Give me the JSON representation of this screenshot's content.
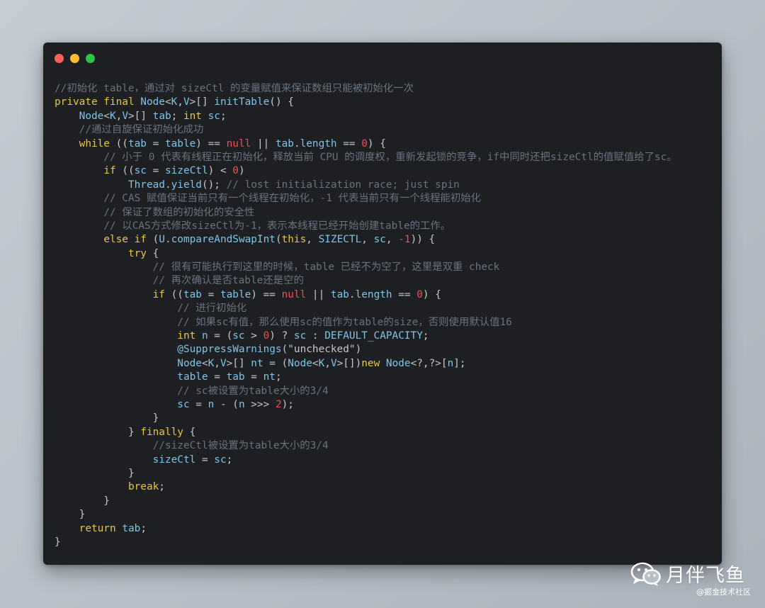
{
  "window": {
    "controls": {
      "close_color": "#fe5f57",
      "minimize_color": "#febc2e",
      "maximize_color": "#28c840"
    }
  },
  "code_lines": [
    [
      [
        "cm",
        "//初始化 table，通过对 sizeCtl 的变量赋值来保证数组只能被初始化一次"
      ]
    ],
    [
      [
        "kw",
        "private final "
      ],
      [
        "ty",
        "Node"
      ],
      [
        "op",
        "<"
      ],
      [
        "ty",
        "K"
      ],
      [
        "op",
        ","
      ],
      [
        "ty",
        "V"
      ],
      [
        "op",
        ">[] "
      ],
      [
        "id",
        "initTable"
      ],
      [
        "op",
        "() {"
      ]
    ],
    [
      [
        "op",
        "    "
      ],
      [
        "ty",
        "Node"
      ],
      [
        "op",
        "<"
      ],
      [
        "ty",
        "K"
      ],
      [
        "op",
        ","
      ],
      [
        "ty",
        "V"
      ],
      [
        "op",
        ">[] "
      ],
      [
        "id",
        "tab"
      ],
      [
        "op",
        "; "
      ],
      [
        "kw",
        "int "
      ],
      [
        "id",
        "sc"
      ],
      [
        "op",
        ";"
      ]
    ],
    [
      [
        "op",
        "    "
      ],
      [
        "cm",
        "//通过自旋保证初始化成功"
      ]
    ],
    [
      [
        "op",
        "    "
      ],
      [
        "kw",
        "while "
      ],
      [
        "op",
        "(("
      ],
      [
        "id",
        "tab"
      ],
      [
        "op",
        " = "
      ],
      [
        "id",
        "table"
      ],
      [
        "op",
        ") == "
      ],
      [
        "lit",
        "null"
      ],
      [
        "op",
        " || "
      ],
      [
        "id",
        "tab"
      ],
      [
        "op",
        "."
      ],
      [
        "id",
        "length"
      ],
      [
        "op",
        " == "
      ],
      [
        "num",
        "0"
      ],
      [
        "op",
        ") {"
      ]
    ],
    [
      [
        "op",
        "        "
      ],
      [
        "cm",
        "// 小于 0 代表有线程正在初始化，释放当前 CPU 的调度权，重新发起锁的竞争，if中同时还把sizeCtl的值赋值给了sc。"
      ]
    ],
    [
      [
        "op",
        "        "
      ],
      [
        "kw",
        "if "
      ],
      [
        "op",
        "(("
      ],
      [
        "id",
        "sc"
      ],
      [
        "op",
        " = "
      ],
      [
        "id",
        "sizeCtl"
      ],
      [
        "op",
        ") < "
      ],
      [
        "num",
        "0"
      ],
      [
        "op",
        ")"
      ]
    ],
    [
      [
        "op",
        "            "
      ],
      [
        "ty",
        "Thread"
      ],
      [
        "op",
        "."
      ],
      [
        "id",
        "yield"
      ],
      [
        "op",
        "(); "
      ],
      [
        "cm",
        "// lost initialization race; just spin"
      ]
    ],
    [
      [
        "op",
        "        "
      ],
      [
        "cm",
        "// CAS 赋值保证当前只有一个线程在初始化，-1 代表当前只有一个线程能初始化"
      ]
    ],
    [
      [
        "op",
        "        "
      ],
      [
        "cm",
        "// 保证了数组的初始化的安全性"
      ]
    ],
    [
      [
        "op",
        "        "
      ],
      [
        "cm",
        "// 以CAS方式修改sizeCtl为-1，表示本线程已经开始创建table的工作。"
      ]
    ],
    [
      [
        "op",
        "        "
      ],
      [
        "kw",
        "else if "
      ],
      [
        "op",
        "("
      ],
      [
        "ty",
        "U"
      ],
      [
        "op",
        "."
      ],
      [
        "id",
        "compareAndSwapInt"
      ],
      [
        "op",
        "("
      ],
      [
        "kw",
        "this"
      ],
      [
        "op",
        ", "
      ],
      [
        "id",
        "SIZECTL"
      ],
      [
        "op",
        ", "
      ],
      [
        "id",
        "sc"
      ],
      [
        "op",
        ", "
      ],
      [
        "num",
        "-1"
      ],
      [
        "op",
        ")) {"
      ]
    ],
    [
      [
        "op",
        "            "
      ],
      [
        "kw",
        "try "
      ],
      [
        "op",
        "{"
      ]
    ],
    [
      [
        "op",
        "                "
      ],
      [
        "cm",
        "// 很有可能执行到这里的时候，table 已经不为空了，这里是双重 check"
      ]
    ],
    [
      [
        "op",
        "                "
      ],
      [
        "cm",
        "// 再次确认是否table还是空的"
      ]
    ],
    [
      [
        "op",
        "                "
      ],
      [
        "kw",
        "if "
      ],
      [
        "op",
        "(("
      ],
      [
        "id",
        "tab"
      ],
      [
        "op",
        " = "
      ],
      [
        "id",
        "table"
      ],
      [
        "op",
        ") == "
      ],
      [
        "lit",
        "null"
      ],
      [
        "op",
        " || "
      ],
      [
        "id",
        "tab"
      ],
      [
        "op",
        "."
      ],
      [
        "id",
        "length"
      ],
      [
        "op",
        " == "
      ],
      [
        "num",
        "0"
      ],
      [
        "op",
        ") {"
      ]
    ],
    [
      [
        "op",
        "                    "
      ],
      [
        "cm",
        "// 进行初始化"
      ]
    ],
    [
      [
        "op",
        "                    "
      ],
      [
        "cm",
        "// 如果sc有值，那么使用sc的值作为table的size，否则使用默认值16"
      ]
    ],
    [
      [
        "op",
        "                    "
      ],
      [
        "kw",
        "int "
      ],
      [
        "id",
        "n"
      ],
      [
        "op",
        " = ("
      ],
      [
        "id",
        "sc"
      ],
      [
        "op",
        " > "
      ],
      [
        "num",
        "0"
      ],
      [
        "op",
        ") ? "
      ],
      [
        "id",
        "sc"
      ],
      [
        "op",
        " : "
      ],
      [
        "id",
        "DEFAULT_CAPACITY"
      ],
      [
        "op",
        ";"
      ]
    ],
    [
      [
        "op",
        "                    "
      ],
      [
        "ty",
        "@SuppressWarnings"
      ],
      [
        "op",
        "("
      ],
      [
        "str",
        "\"unchecked\""
      ],
      [
        "op",
        ")"
      ]
    ],
    [
      [
        "op",
        "                    "
      ],
      [
        "ty",
        "Node"
      ],
      [
        "op",
        "<"
      ],
      [
        "ty",
        "K"
      ],
      [
        "op",
        ","
      ],
      [
        "ty",
        "V"
      ],
      [
        "op",
        ">[] "
      ],
      [
        "id",
        "nt"
      ],
      [
        "op",
        " = ("
      ],
      [
        "ty",
        "Node"
      ],
      [
        "op",
        "<"
      ],
      [
        "ty",
        "K"
      ],
      [
        "op",
        ","
      ],
      [
        "ty",
        "V"
      ],
      [
        "op",
        ">[])"
      ],
      [
        "kw",
        "new "
      ],
      [
        "ty",
        "Node"
      ],
      [
        "op",
        "<?,?>["
      ],
      [
        "id",
        "n"
      ],
      [
        "op",
        "];"
      ]
    ],
    [
      [
        "op",
        "                    "
      ],
      [
        "id",
        "table"
      ],
      [
        "op",
        " = "
      ],
      [
        "id",
        "tab"
      ],
      [
        "op",
        " = "
      ],
      [
        "id",
        "nt"
      ],
      [
        "op",
        ";"
      ]
    ],
    [
      [
        "op",
        "                    "
      ],
      [
        "cm",
        "// sc被设置为table大小的3/4"
      ]
    ],
    [
      [
        "op",
        "                    "
      ],
      [
        "id",
        "sc"
      ],
      [
        "op",
        " = "
      ],
      [
        "id",
        "n"
      ],
      [
        "op",
        " - ("
      ],
      [
        "id",
        "n"
      ],
      [
        "op",
        " >>> "
      ],
      [
        "num",
        "2"
      ],
      [
        "op",
        ");"
      ]
    ],
    [
      [
        "op",
        "                }"
      ]
    ],
    [
      [
        "op",
        "            } "
      ],
      [
        "kw",
        "finally "
      ],
      [
        "op",
        "{"
      ]
    ],
    [
      [
        "op",
        "                "
      ],
      [
        "cm",
        "//sizeCtl被设置为table大小的3/4"
      ]
    ],
    [
      [
        "op",
        "                "
      ],
      [
        "id",
        "sizeCtl"
      ],
      [
        "op",
        " = "
      ],
      [
        "id",
        "sc"
      ],
      [
        "op",
        ";"
      ]
    ],
    [
      [
        "op",
        "            }"
      ]
    ],
    [
      [
        "op",
        "            "
      ],
      [
        "kw",
        "break"
      ],
      [
        "op",
        ";"
      ]
    ],
    [
      [
        "op",
        "        }"
      ]
    ],
    [
      [
        "op",
        "    }"
      ]
    ],
    [
      [
        "op",
        "    "
      ],
      [
        "kw",
        "return "
      ],
      [
        "id",
        "tab"
      ],
      [
        "op",
        ";"
      ]
    ],
    [
      [
        "op",
        "}"
      ]
    ]
  ],
  "watermark": {
    "icon": "wechat-icon",
    "name": "月伴飞鱼",
    "source": "@掘金技术社区"
  }
}
